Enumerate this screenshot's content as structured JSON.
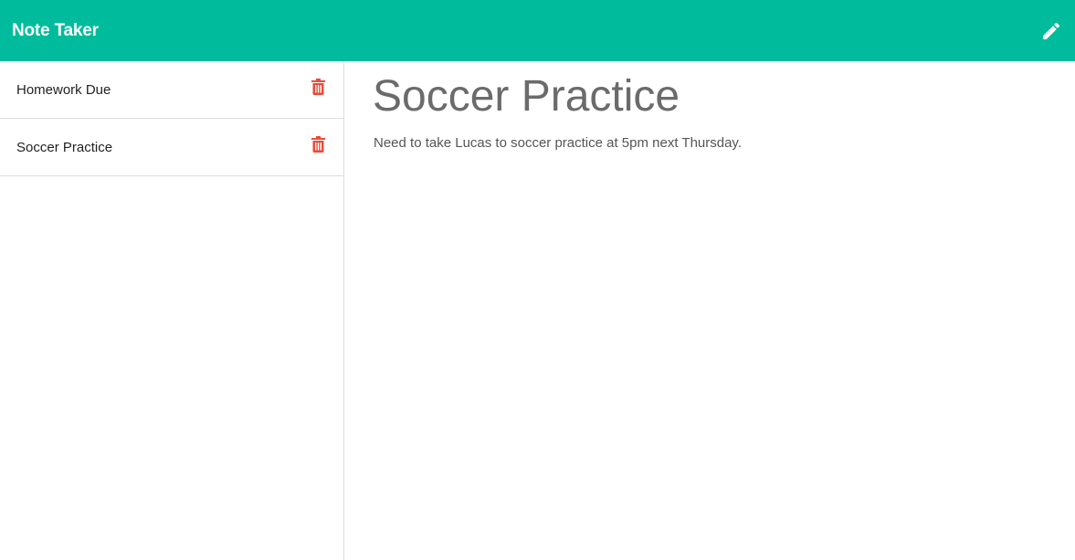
{
  "app": {
    "brand": "Note Taker",
    "new_note_icon": "pencil-icon",
    "accent_color": "#00bc9c",
    "delete_color": "#e74c3c"
  },
  "sidebar": {
    "notes": [
      {
        "title": "Homework Due",
        "delete_icon": "trash-icon"
      },
      {
        "title": "Soccer Practice",
        "delete_icon": "trash-icon"
      }
    ]
  },
  "main": {
    "note_title": "Soccer Practice",
    "note_text": "Need to take Lucas to soccer practice at 5pm next Thursday."
  }
}
